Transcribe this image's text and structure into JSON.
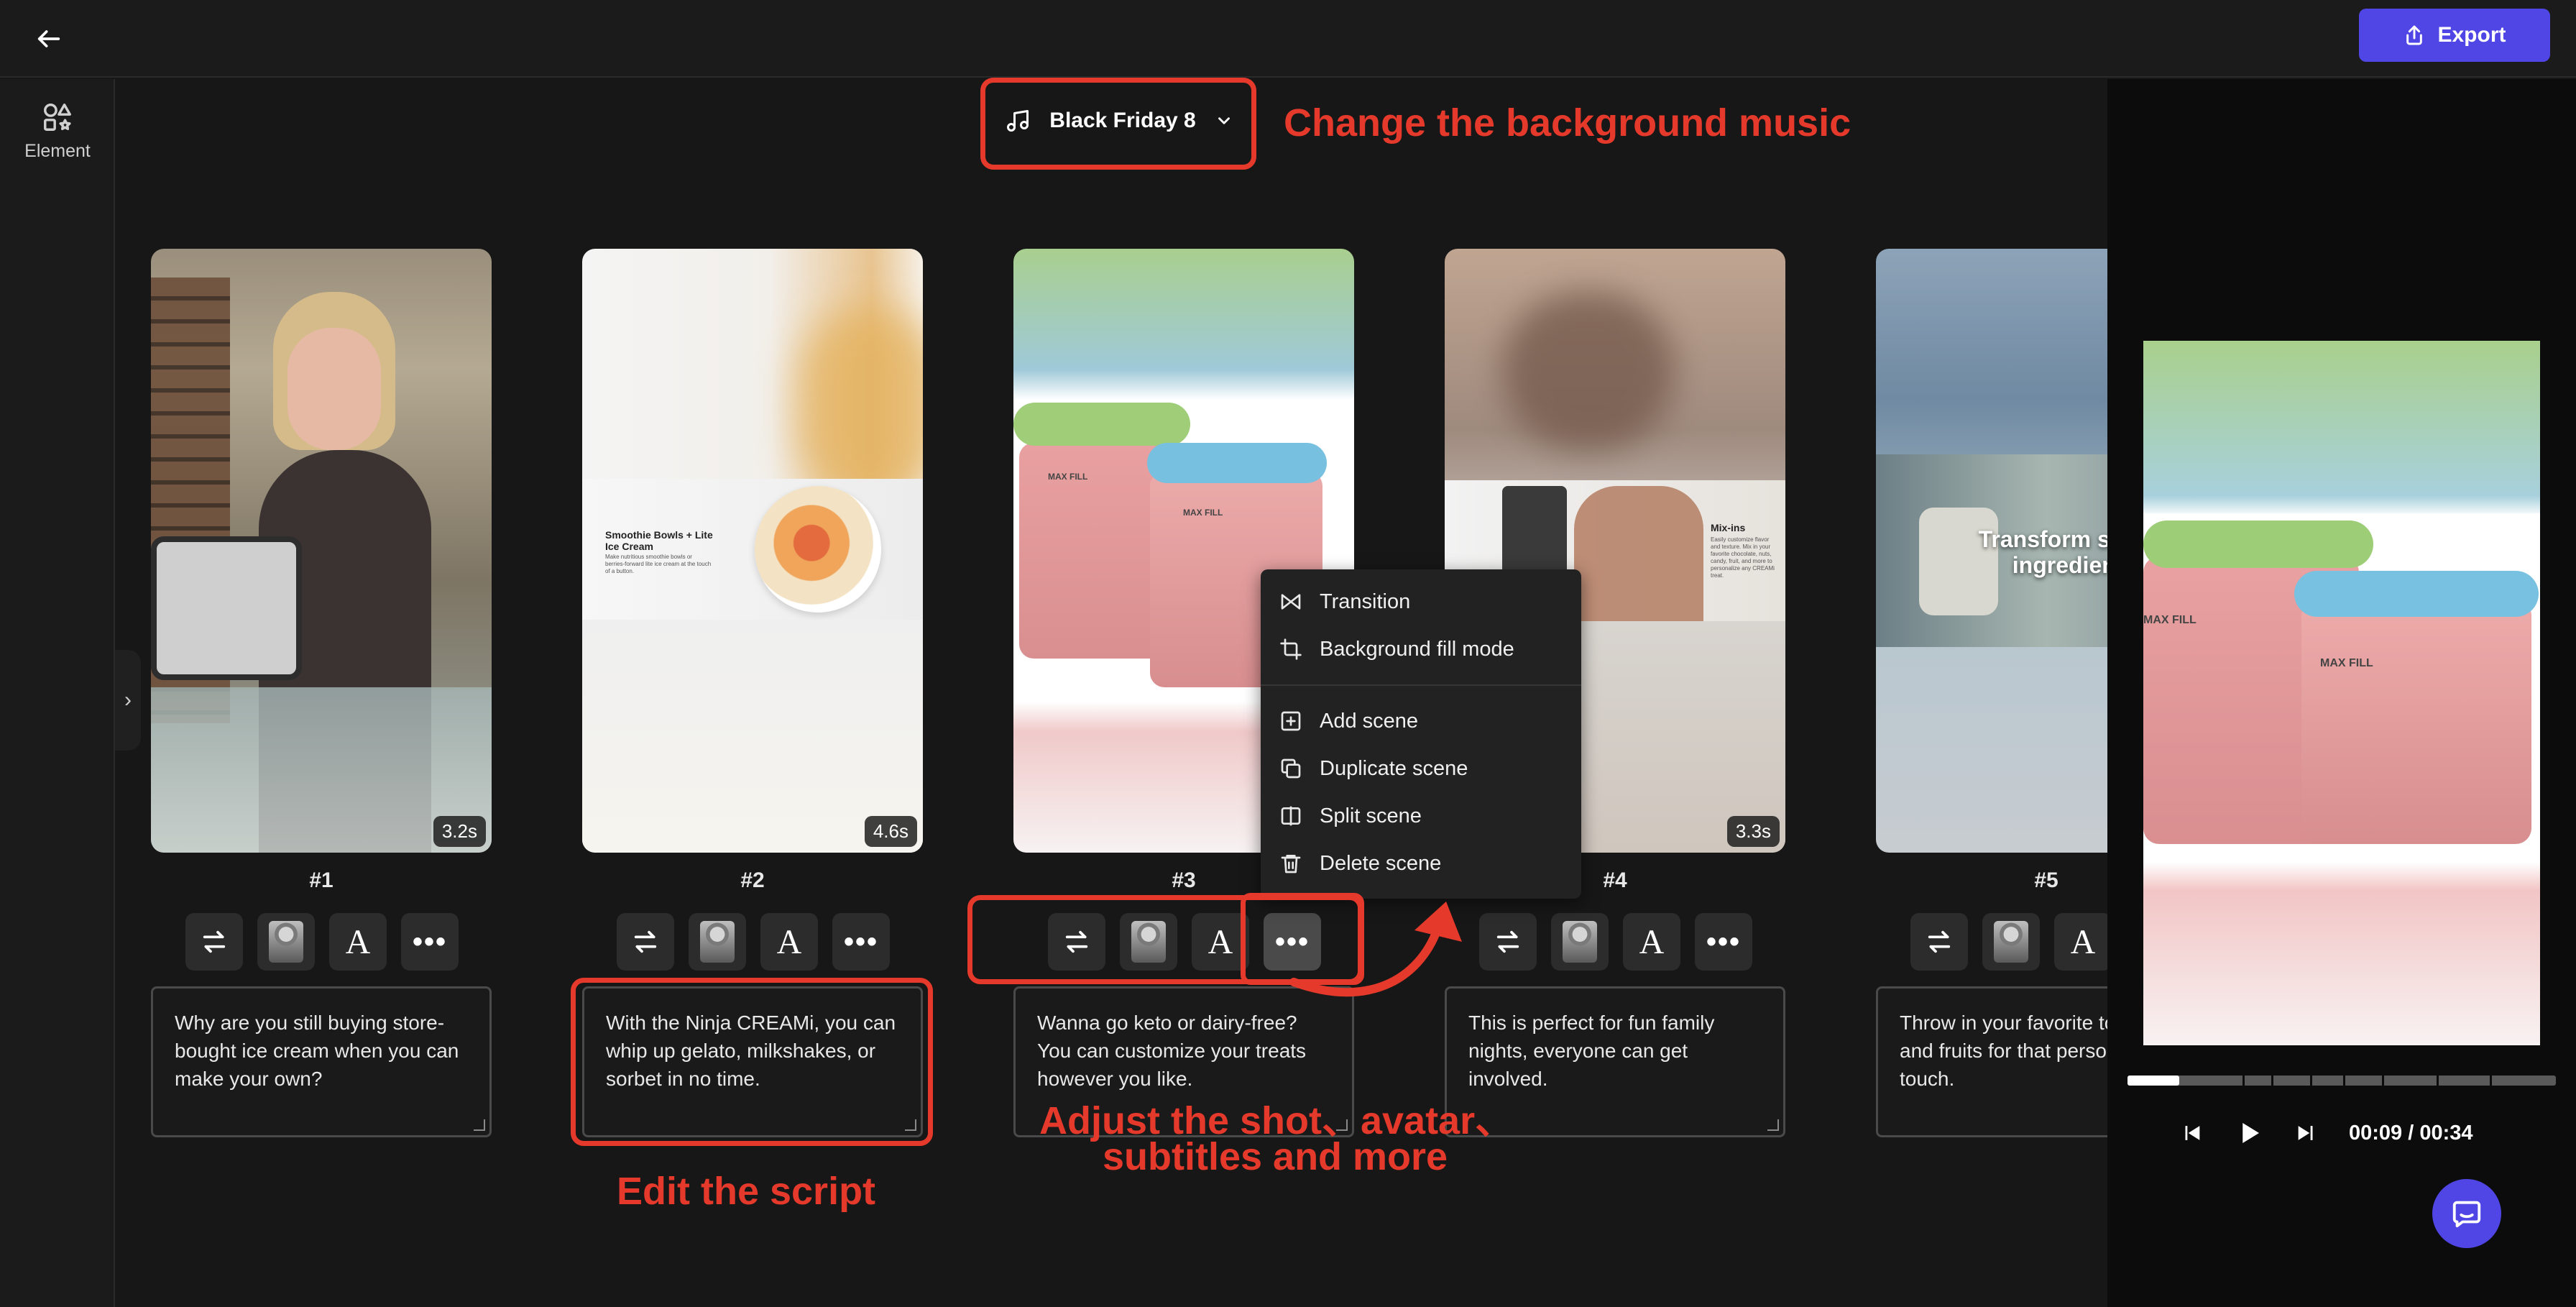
{
  "topbar": {
    "export_label": "Export"
  },
  "sidebar": {
    "element_label": "Element"
  },
  "music": {
    "track": "Black Friday 8"
  },
  "annotations": {
    "music": "Change the background music",
    "script": "Edit the script",
    "adjust_line1": "Adjust the shot、avatar、",
    "adjust_line2": "subtitles and more"
  },
  "scenes": [
    {
      "number": "#1",
      "duration": "3.2s",
      "script": "Why are you still buying store-bought ice cream when you can make your own?"
    },
    {
      "number": "#2",
      "duration": "4.6s",
      "script": "With the Ninja CREAMi, you can whip up gelato, milkshakes, or sorbet in no time.",
      "inset_title": "Smoothie Bowls + Lite Ice Cream",
      "inset_body": "Make nutritious smoothie bowls or berries-forward lite ice cream at the touch of a button."
    },
    {
      "number": "#3",
      "duration": "",
      "script": "Wanna go keto or dairy-free? You can customize your treats however you like.",
      "jar_label": "MAX FILL"
    },
    {
      "number": "#4",
      "duration": "3.3s",
      "script": "This is perfect for fun family nights, everyone can get involved.",
      "inset_title": "Mix-ins",
      "inset_body": "Easily customize flavor and texture. Mix in your favorite chocolate, nuts, candy, fruit, and more to personalize any CREAMi treat."
    },
    {
      "number": "#5",
      "duration": "",
      "script": "Throw in your favorite toppings and fruits for that personal touch.",
      "overlay_text": "Transform simple ingredients"
    }
  ],
  "context_menu": {
    "transition": "Transition",
    "background_fill": "Background fill mode",
    "add_scene": "Add scene",
    "duplicate_scene": "Duplicate scene",
    "split_scene": "Split scene",
    "delete_scene": "Delete scene"
  },
  "player": {
    "time": "00:09 / 00:34",
    "progress": 0.12
  },
  "colors": {
    "accent": "#4f46e5",
    "annotation": "#e5392b"
  }
}
